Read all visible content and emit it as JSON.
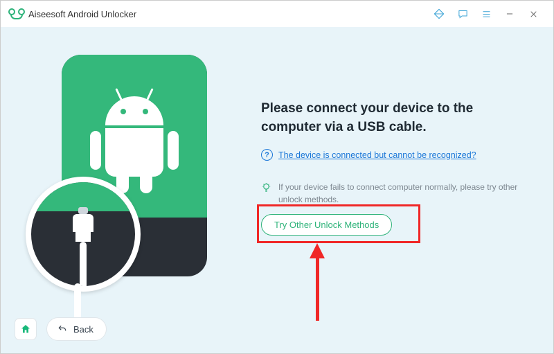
{
  "titlebar": {
    "app_title": "Aiseesoft Android Unlocker"
  },
  "main": {
    "headline": "Please connect your device to the computer via a USB cable.",
    "help_link": "The device is connected but cannot be recognized?",
    "tip_text": "If your device fails to connect computer normally, please try other unlock methods.",
    "try_other_label": "Try Other Unlock Methods"
  },
  "footer": {
    "back_label": "Back"
  }
}
